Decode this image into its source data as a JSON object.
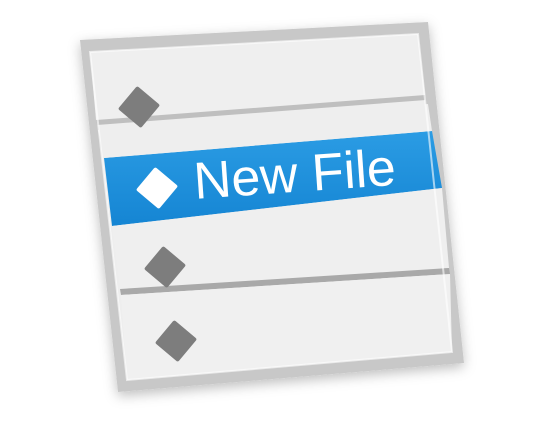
{
  "icon": {
    "semantic": "new-file-list-icon",
    "colors": {
      "frame": "#b7b7b7",
      "row_bg": "#eeeeee",
      "divider": "#a9a9a9",
      "selected_row": "#1d91de",
      "diamond": "#7d7d7d",
      "diamond_selected": "#ffffff",
      "label": "#ffffff"
    }
  },
  "list": {
    "rows": [
      {
        "label": "",
        "selected": false,
        "icon": "diamond-icon"
      },
      {
        "label": "New File",
        "selected": true,
        "icon": "diamond-icon"
      },
      {
        "label": "",
        "selected": false,
        "icon": "diamond-icon"
      },
      {
        "label": "",
        "selected": false,
        "icon": "diamond-icon"
      }
    ]
  }
}
